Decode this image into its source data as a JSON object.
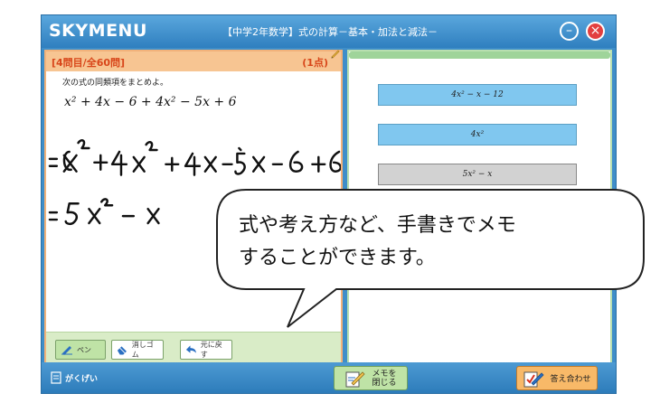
{
  "app": {
    "brand": "SKYMENU",
    "title": "【中学2年数学】式の計算－基本・加法と減法－",
    "minimize_label": "–",
    "close_label": "×"
  },
  "question": {
    "number": "[4問目/全60問]",
    "points": "(1点)",
    "instruction": "次の式の同類項をまとめよ。",
    "expression": "x² + 4x − 6 + 4x² − 5x + 6"
  },
  "handwriting": {
    "line1": "=x²+4x²+4x-5x-6+6",
    "line2": "= 5x² - x"
  },
  "toolbar": {
    "pen_label": "ペン",
    "eraser_label": "消しゴム",
    "undo_label": "元に戻す"
  },
  "choices": [
    {
      "label": "4x² − x − 12"
    },
    {
      "label": "4x²"
    },
    {
      "label": "5x² − x"
    }
  ],
  "callout": {
    "text_line1": "式や考え方など、手書きでメモ",
    "text_line2": "することができます。"
  },
  "bottom": {
    "logo_text": "がくげい",
    "memo_button_line1": "メモを",
    "memo_button_line2": "閉じる",
    "answer_button_label": "答え合わせ"
  },
  "colors": {
    "titlebar": "#2f7fbf",
    "question_header": "#f7c592",
    "choice_selected": "#80c7ef",
    "choice_unselected": "#d2d2d2",
    "close_button": "#e23f3f"
  }
}
